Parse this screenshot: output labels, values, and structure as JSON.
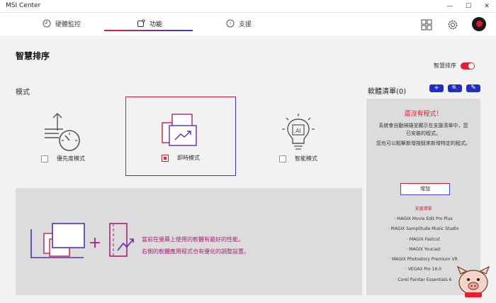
{
  "window": {
    "title": "MSI Center",
    "minimize": "—",
    "maximize": "☐",
    "close": "✕"
  },
  "tabs": [
    {
      "label": "硬體監控",
      "icon": "gauge-icon"
    },
    {
      "label": "功能",
      "icon": "features-icon"
    },
    {
      "label": "支援",
      "icon": "help-icon"
    }
  ],
  "active_tab": "功能",
  "colors": {
    "accent_red": "#e5202e",
    "accent_blue": "#3a33c8",
    "button_blue": "#1f2fc6",
    "info_text": "#a8227a"
  },
  "page": {
    "title": "智慧排序"
  },
  "toggle": {
    "label": "智慧排序",
    "state": "on"
  },
  "modes_section": {
    "label": "模式"
  },
  "modes": [
    {
      "label": "優先度模式",
      "checked": false,
      "icon": "speed-priority-icon"
    },
    {
      "label": "即時模式",
      "checked": true,
      "icon": "realtime-windows-icon"
    },
    {
      "label": "智能模式",
      "checked": false,
      "icon": "ai-bulb-icon"
    }
  ],
  "info": {
    "line1": "當前在螢幕上使用的軟體有最好的性能。",
    "line2": "右側的軟體應用程式也有優化的調整設置。"
  },
  "software_list": {
    "title": "軟體清單(0)",
    "buttons": [
      "+",
      "🔍",
      "✎"
    ],
    "empty_title": "還沒有程式！",
    "desc1_l1": "系統會自動掃描並顯示在支援清單中，您",
    "desc1_l2": "已安裝的程式。",
    "desc2_l1": "您也可以點擊新增按鈕來新增特定的程式。",
    "add_button": "增加",
    "supported_title": "支援清單",
    "supported_apps": [
      "· MAGIX Movie Edit Pro Plus",
      "· MAGIX Samplitude Music Studio",
      "· MAGIX Fastcut",
      "· MAGIX Youcast",
      "· MAGIX Photostory Premium VR",
      "· VEGAS Pro 16.0",
      "· Corel Painter Essentials 6"
    ]
  }
}
